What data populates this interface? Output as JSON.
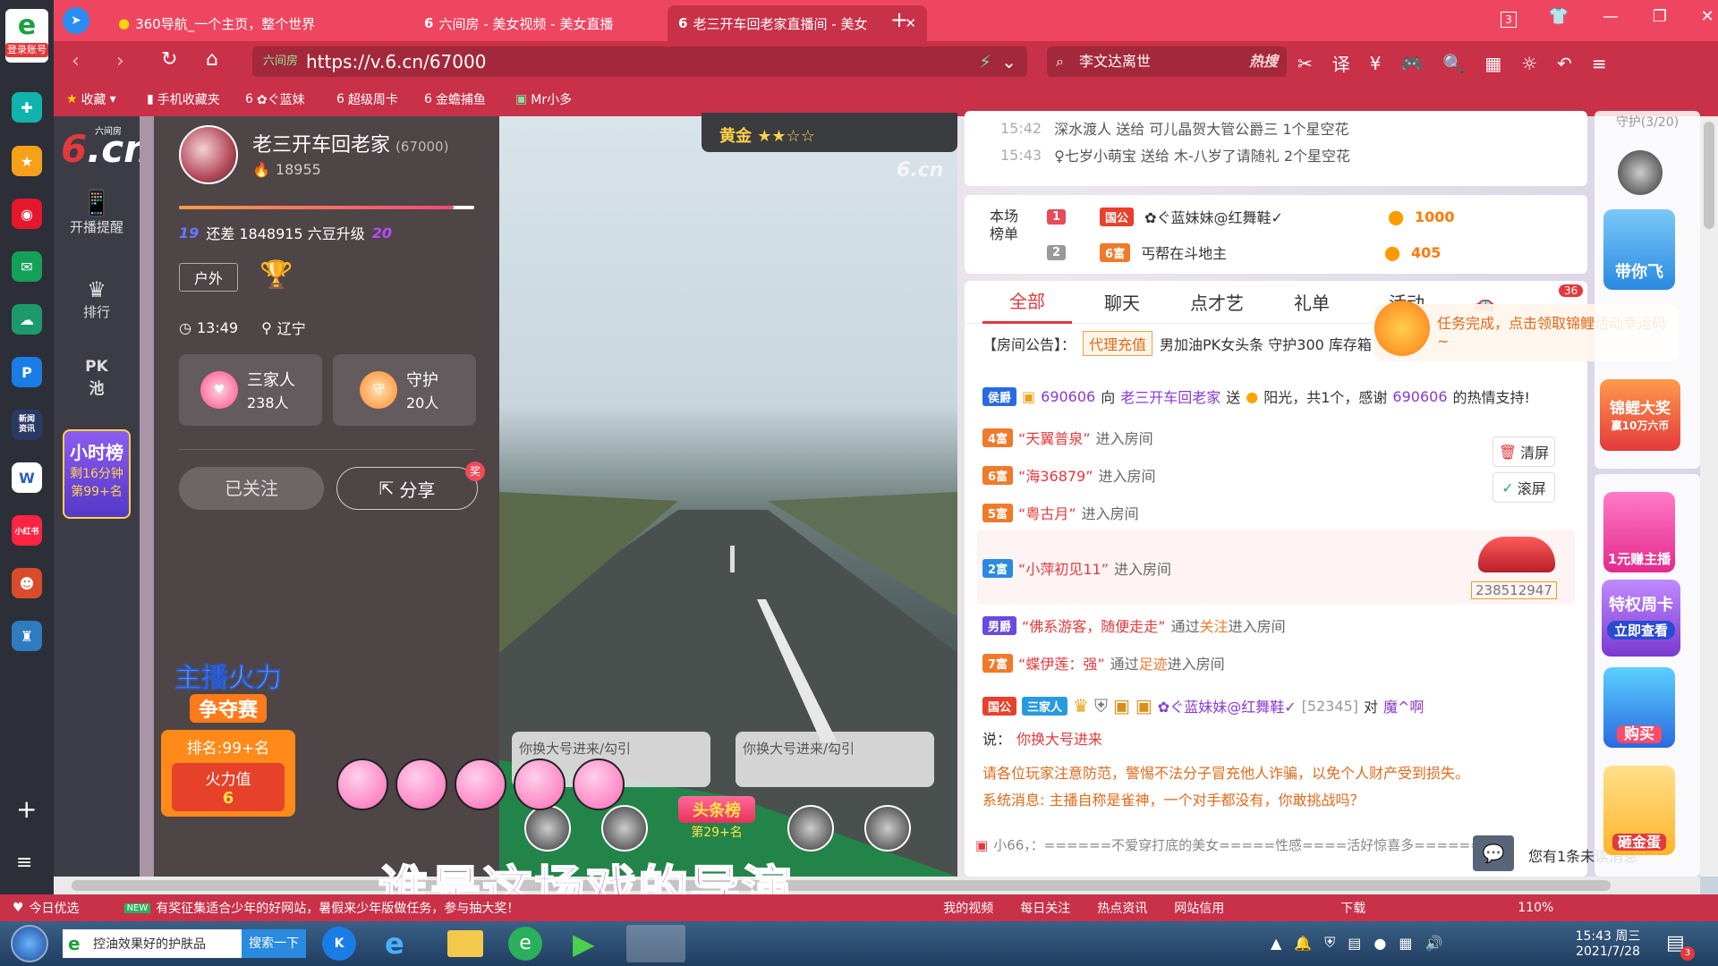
{
  "sidebar_left": {
    "login_label": "登录账号",
    "icons": [
      "browser-logo-icon",
      "plus-app-icon",
      "star-app-icon",
      "weibo-icon",
      "mail-icon",
      "cloud-icon",
      "p-app-icon",
      "news-icon",
      "word-icon",
      "xiaohongshu-icon",
      "game-icon",
      "game2-icon"
    ],
    "weibo_label": "",
    "news_label": "新闻\n资讯",
    "xiaohongshu_label": "小红书",
    "add_label": "+",
    "menu_label": "≡"
  },
  "tabs": [
    {
      "label": "360导航_一个主页，整个世界",
      "icon": "360-icon"
    },
    {
      "label": "六间房 - 美女视频 - 美女直播",
      "icon": "6cn-icon"
    },
    {
      "label": "老三开车回老家直播间 - 美女",
      "icon": "6cn-icon"
    }
  ],
  "window_controls": {
    "tabs_count": "3"
  },
  "address": {
    "site_tag": "六间房",
    "url": "https://v.6.cn/67000",
    "search_text": "李文达离世",
    "hot_label": "热搜"
  },
  "favorites": [
    {
      "label": "收藏"
    },
    {
      "label": "手机收藏夹"
    },
    {
      "label": "✿ぐ蓝妹"
    },
    {
      "label": "超级周卡"
    },
    {
      "label": "金蟾捕鱼"
    },
    {
      "label": "Mr小多"
    }
  ],
  "nav6": {
    "logo_small": "六间房",
    "logo": "6.cn",
    "items": [
      "开播提醒",
      "排行",
      "PK 池"
    ],
    "hour_rank": {
      "title": "小时榜",
      "remaining": "剩16分钟",
      "rank": "第99+名"
    }
  },
  "anchor": {
    "name": "老三开车回老家",
    "id": "(67000)",
    "fans": "18955",
    "level_from": "19",
    "level_to": "20",
    "level_text": "还差 1848915 六豆升级",
    "tag": "户外",
    "time": "13:49",
    "location": "辽宁",
    "family_label": "三家人",
    "family_count": "238人",
    "guard_label": "守护",
    "guard_count": "20人",
    "followed_label": "已关注",
    "share_label": "分享",
    "share_badge": "奖",
    "fire_title": "主播火力",
    "fire_sub": "争夺赛",
    "fire_rank": "排名:99+名",
    "fire_value_label": "火力值",
    "fire_value": "6",
    "progress": 0.93
  },
  "video": {
    "watermark": "6.cn",
    "medal": "黄金",
    "bubble1": "你换大号进来/勾引",
    "bubble2": "你换大号进来/勾引",
    "top_banner": "头条榜",
    "top_rank": "第29+名",
    "subtitle": "谁是这场戏的导演"
  },
  "chat_top": [
    {
      "time": "15:42",
      "text": "深水渡人 送给 可儿晶贺大管公爵三 1个星空花"
    },
    {
      "time": "15:43",
      "text": "♀七岁小萌宝 送给 木-八岁了请随礼 2个星空花"
    }
  ],
  "rank_board": {
    "title": "本场\n榜单",
    "rows": [
      {
        "rank": "1",
        "badge": "国公",
        "name": "✿ぐ蓝妹妹@红舞鞋✓",
        "score": "1000"
      },
      {
        "rank": "2",
        "badge": "6富",
        "name": "丐帮在斗地主",
        "score": "405"
      }
    ]
  },
  "chat_tabs": [
    "全部",
    "聊天",
    "点才艺",
    "礼单",
    "活动"
  ],
  "chat_tab_badge": "36",
  "task_tip": "任务完成，点击领取锦鲤活动幸运码~",
  "announcement": {
    "label": "【房间公告】：",
    "tag": "代理充值",
    "text": "男加油PK女头条 守护300 库存箱"
  },
  "chat": [
    {
      "badge": "侯爵",
      "user": "690606",
      "mid": "向",
      "target": "老三开车回老家",
      "action": "送",
      "gift_text": "阳光，共1个，感谢",
      "thanks_user": "690606",
      "tail": "的热情支持!"
    },
    {
      "badge": "4富",
      "name": "“天翼普泉”",
      "text": "进入房间"
    },
    {
      "badge": "6富",
      "name": "“海36879”",
      "text": "进入房间"
    },
    {
      "badge": "5富",
      "name": "“粤古月”",
      "text": "进入房间"
    },
    {
      "badge": "2富",
      "name": "“小萍初见11”",
      "text": "进入房间"
    },
    {
      "badge": "男爵",
      "name": "“佛系游客，随便走走”",
      "text": "通过",
      "via": "关注",
      "tail": "进入房间"
    },
    {
      "badge": "7富",
      "name": "“蝶伊莲：强”",
      "text": "通过",
      "via": "足迹",
      "tail": "进入房间"
    }
  ],
  "car_id": "238512947",
  "clear_label": "清屏",
  "scroll_label": "滚屏",
  "last_msg": {
    "badge": "国公",
    "family": "三家人",
    "user": "✿ぐ蓝妹妹@红舞鞋✓",
    "uid": "[52345]",
    "to": "对",
    "target": "魔^啊",
    "say": "说：",
    "content": "你换大号进来"
  },
  "notice": "请各位玩家注意防范，警惕不法分子冒充他人诈骗，以免个人财产受到损失。",
  "system": "系统消息: 主播自称是雀神，一个对手都没有，你敢挑战吗？",
  "marquee": "小66，：======不爱穿打底的美女=====性感====活好惊喜多======",
  "unread": "您有1条未读消息",
  "right_strip": {
    "top_label": "守护(3/20)",
    "promo1": "带你飞",
    "promo2": "锦鲤大奖",
    "promo2_sub": "赢10万六币",
    "promo3": "1元赚主播",
    "promo4": "特权周卡",
    "promo4_btn": "立即查看",
    "promo5": "购买",
    "promo6": "砸金蛋"
  },
  "status_bar": {
    "left": "今日优选",
    "news": "有奖征集适合少年的好网站，暑假来少年版做任务，参与抽大奖！",
    "items": [
      "我的视频",
      "每日关注",
      "热点资讯",
      "网站信用",
      "下载"
    ],
    "zoom": "110%"
  },
  "taskbar": {
    "search_placeholder": "控油效果好的护肤品",
    "search_btn": "搜索一下",
    "time": "15:43 周三",
    "date": "2021/7/28",
    "badge": "3"
  }
}
